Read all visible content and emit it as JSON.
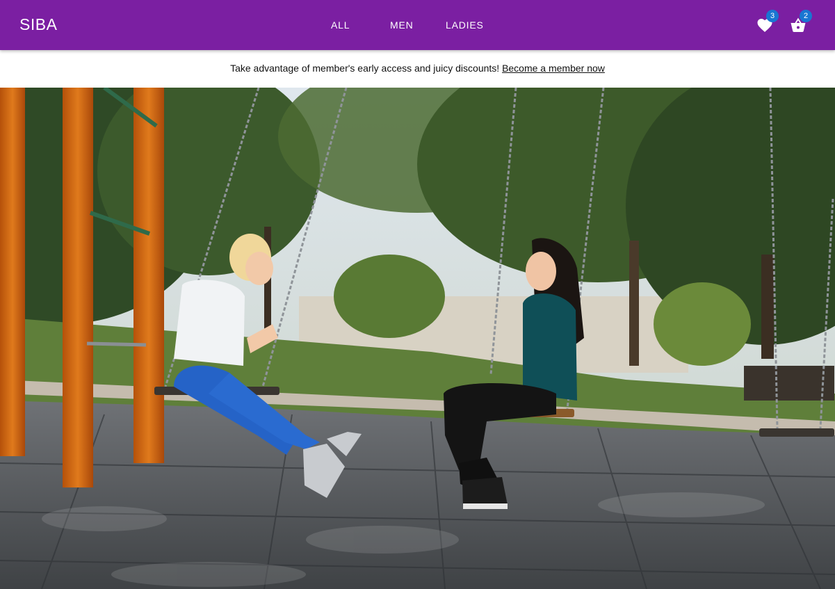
{
  "header": {
    "brand": "SIBA",
    "nav": [
      "ALL",
      "MEN",
      "LADIES"
    ],
    "wishlist_count": "3",
    "cart_count": "2",
    "bg_color": "#7b1fa2",
    "badge_color": "#1976d2",
    "wishlist_icon": "heart-icon",
    "cart_icon": "basket-icon"
  },
  "promo": {
    "text": "Take advantage of member's early access and juicy discounts!",
    "link_text": "Become a member now"
  },
  "hero": {
    "image": "hero-photo-two-women-on-playground-swings"
  }
}
